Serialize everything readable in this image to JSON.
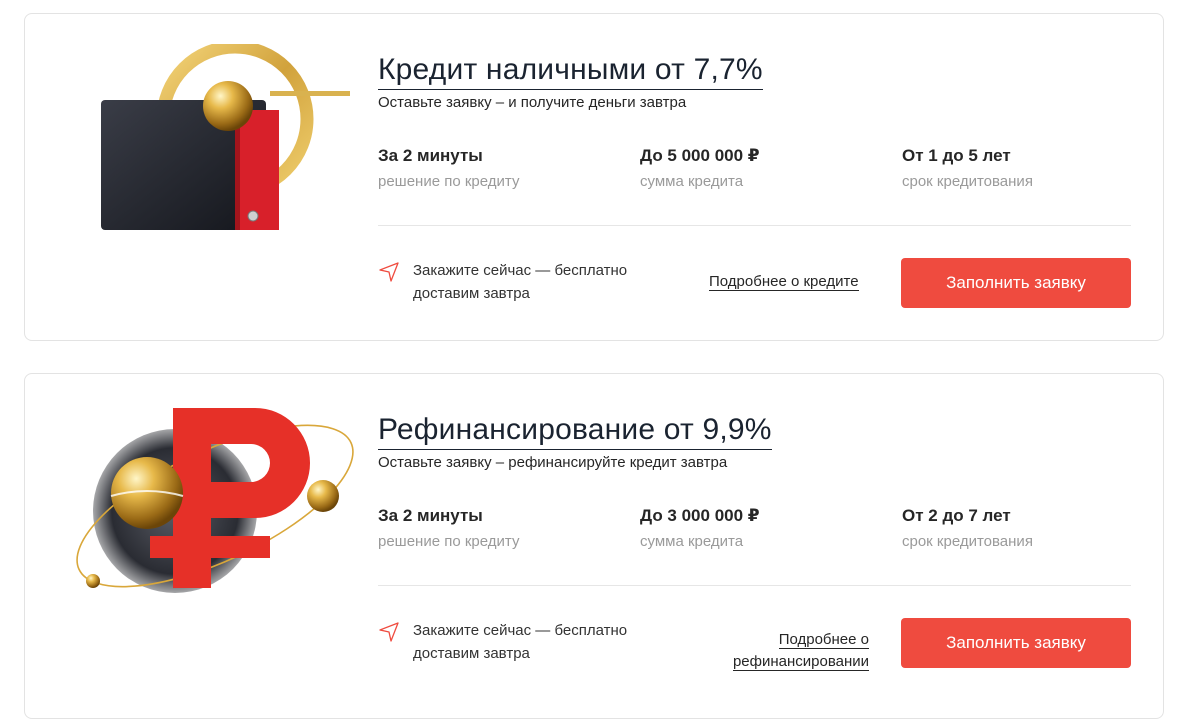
{
  "colors": {
    "accent": "#ef4b3f",
    "title": "#1a2330",
    "muted": "#9a9a9a",
    "gold": "#d9a73a"
  },
  "cards": [
    {
      "title": "Кредит наличными от 7,7%",
      "subtitle": "Оставьте заявку – и получите деньги завтра",
      "stats": [
        {
          "value": "За 2 минуты",
          "label": "решение по кредиту"
        },
        {
          "value": "До 5 000 000 ₽",
          "label": "сумма кредита"
        },
        {
          "value": "От 1 до 5 лет",
          "label": "срок кредитования"
        }
      ],
      "delivery_line1": "Закажите сейчас — бесплатно",
      "delivery_line2": "доставим завтра",
      "more_line1": "Подробнее о кредите",
      "cta": "Заполнить заявку",
      "icons": {
        "illustration": "wallet-gold-ring-icon",
        "delivery": "navigation-arrow-icon"
      }
    },
    {
      "title": "Рефинансирование от 9,9%",
      "subtitle": "Оставьте заявку – рефинансируйте кредит завтра",
      "stats": [
        {
          "value": "За 2 минуты",
          "label": "решение по кредиту"
        },
        {
          "value": "До 3 000 000 ₽",
          "label": "сумма кредита"
        },
        {
          "value": "От 2 до 7 лет",
          "label": "срок кредитования"
        }
      ],
      "delivery_line1": "Закажите сейчас — бесплатно",
      "delivery_line2": "доставим завтра",
      "more_line1": "Подробнее о",
      "more_line2": "рефинансировании",
      "cta": "Заполнить заявку",
      "icons": {
        "illustration": "ruble-orbit-icon",
        "delivery": "navigation-arrow-icon"
      }
    }
  ]
}
